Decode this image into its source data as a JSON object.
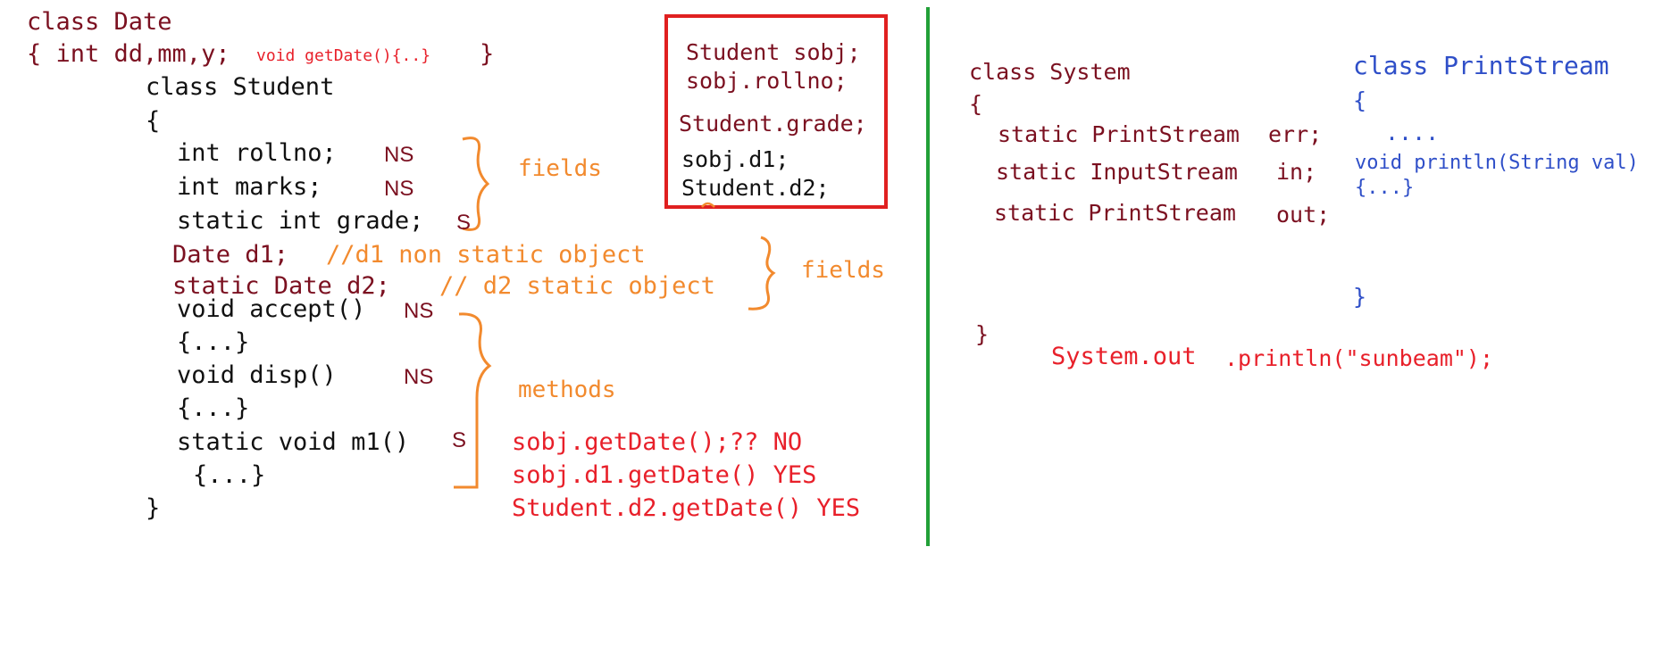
{
  "colors": {
    "dark_red": "#7b1020",
    "red": "#e8202a",
    "black": "#111111",
    "orange": "#f28a2e",
    "blue": "#2f4fc8",
    "green": "#22a038",
    "box_red": "#e02020"
  },
  "left": {
    "date_class": "class Date",
    "date_body": "{ int dd,mm,y;",
    "date_method": "void getDate(){..}",
    "date_close": "}",
    "student_class": "class Student",
    "open_brace": "{",
    "rollno": "int rollno;",
    "rollno_tag": "NS",
    "marks": "int marks;",
    "marks_tag": "NS",
    "grade": "static int grade;",
    "grade_tag": "S",
    "d1": "Date d1;",
    "d1_comment": "//d1 non static object",
    "d2": "static Date d2;",
    "d2_comment": "// d2 static object",
    "accept": "void accept()",
    "accept_tag": "NS",
    "accept_body": "{...}",
    "disp": "void disp()",
    "disp_tag": "NS",
    "disp_body": "{...}",
    "m1": "static void m1()",
    "m1_tag": "S",
    "m1_body": "{...}",
    "close_brace": "}",
    "fields_label_1": "fields",
    "fields_label_2": "fields",
    "methods_label": "methods",
    "calls": [
      "sobj.getDate();?? NO",
      "sobj.d1.getDate() YES",
      "Student.d2.getDate() YES"
    ]
  },
  "box": {
    "lines": [
      "Student sobj;",
      "sobj.rollno;",
      "Student.grade;",
      "sobj.d1;",
      "Student.d2;"
    ]
  },
  "right": {
    "system_class": "class System",
    "open_brace": "{",
    "err_type": "static PrintStream",
    "err_name": "err;",
    "in_type": "static InputStream",
    "in_name": "in;",
    "out_type": "static PrintStream",
    "out_name": "out;",
    "close_brace": "}",
    "call_prefix": "System.out",
    "call_suffix": ".println(\"sunbeam\");",
    "ps_class": "class PrintStream",
    "ps_open": "{",
    "ps_dots": "....",
    "ps_method": "void println(String val)",
    "ps_method_body": "{...}",
    "ps_close": "}"
  }
}
